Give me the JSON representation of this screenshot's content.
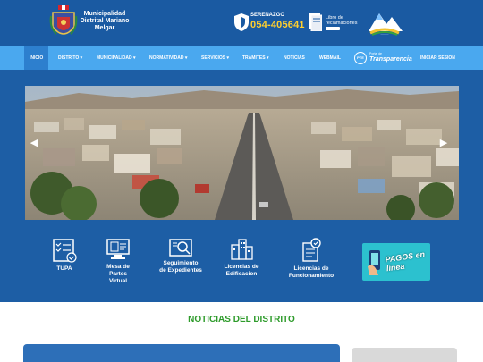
{
  "header": {
    "title": "Municipalidad Distrital Mariano Melgar",
    "serenazgo_label": "SERENAZGO",
    "serenazgo_phone": "054-405641",
    "reclamaciones_label": "Libro de reclamaciones"
  },
  "nav": {
    "items": [
      {
        "label": "INICIO",
        "active": true
      },
      {
        "label": "DISTRITO ▾"
      },
      {
        "label": "MUNICIPALIDAD ▾"
      },
      {
        "label": "NORMATIVIDAD ▾"
      },
      {
        "label": "SERVICIOS ▾"
      },
      {
        "label": "TRAMITES ▾"
      },
      {
        "label": "NOTICIAS"
      },
      {
        "label": "WEBMAIL"
      },
      {
        "label": "INICIAR SESION"
      }
    ],
    "transparencia_circle": "PTE",
    "transparencia_small": "Portal de",
    "transparencia_big": "Transparencia"
  },
  "quick_links": [
    {
      "label": "TUPA"
    },
    {
      "label": "Mesa de Partes Virtual"
    },
    {
      "label": "Seguimiento de Expedientes"
    },
    {
      "label": "Licencias de Edificacion"
    },
    {
      "label": "Licencias de Funcionamiento"
    }
  ],
  "pagos_banner": "PAGOS en línea",
  "news": {
    "title": "NOTICIAS DEL DISTRITO"
  },
  "colors": {
    "header": "#1a5aa2",
    "nav": "#4aa8ef",
    "body": "#1d5ea5",
    "news_title": "#2e9b2b"
  }
}
